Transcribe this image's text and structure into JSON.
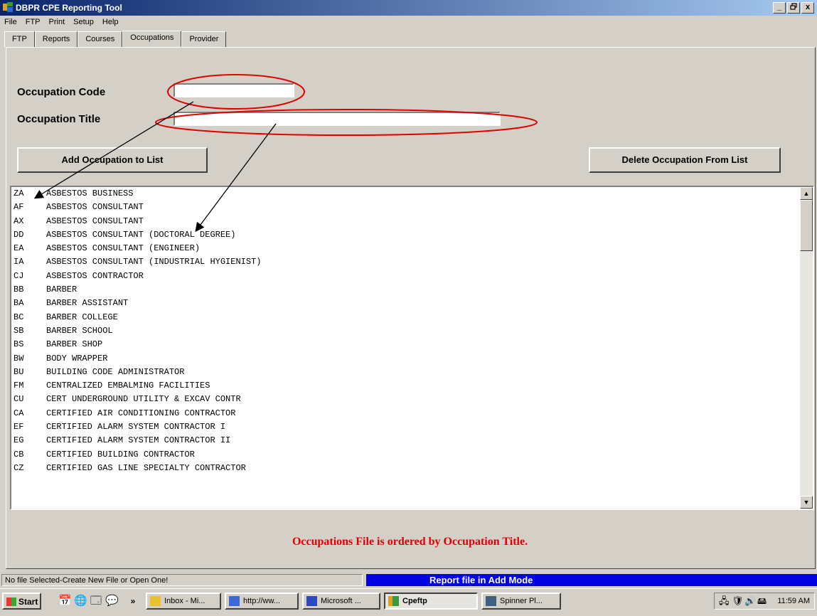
{
  "window": {
    "title": "DBPR CPE Reporting Tool",
    "controls": [
      "_",
      "ȸ",
      "x"
    ]
  },
  "menu": [
    "File",
    "FTP",
    "Print",
    "Setup",
    "Help"
  ],
  "tabs": [
    "FTP",
    "Reports",
    "Courses",
    "Occupations",
    "Provider"
  ],
  "active_tab": "Occupations",
  "form": {
    "code_label": "Occupation Code",
    "code_value": "",
    "title_label": "Occupation Title",
    "title_value": "",
    "add_button": "Add Occupation to List",
    "delete_button": "Delete Occupation From List"
  },
  "occupations": [
    {
      "code": "ZA",
      "title": "ASBESTOS BUSINESS"
    },
    {
      "code": "AF",
      "title": "ASBESTOS CONSULTANT"
    },
    {
      "code": "AX",
      "title": "ASBESTOS CONSULTANT"
    },
    {
      "code": "DD",
      "title": "ASBESTOS CONSULTANT (DOCTORAL DEGREE)"
    },
    {
      "code": "EA",
      "title": "ASBESTOS CONSULTANT (ENGINEER)"
    },
    {
      "code": "IA",
      "title": "ASBESTOS CONSULTANT (INDUSTRIAL HYGIENIST)"
    },
    {
      "code": "CJ",
      "title": "ASBESTOS CONTRACTOR"
    },
    {
      "code": "BB",
      "title": "BARBER"
    },
    {
      "code": "BA",
      "title": "BARBER ASSISTANT"
    },
    {
      "code": "BC",
      "title": "BARBER COLLEGE"
    },
    {
      "code": "SB",
      "title": "BARBER SCHOOL"
    },
    {
      "code": "BS",
      "title": "BARBER SHOP"
    },
    {
      "code": "BW",
      "title": "BODY WRAPPER"
    },
    {
      "code": "BU",
      "title": "BUILDING CODE ADMINISTRATOR"
    },
    {
      "code": "FM",
      "title": "CENTRALIZED EMBALMING FACILITIES"
    },
    {
      "code": "CU",
      "title": "CERT UNDERGROUND UTILITY & EXCAV CONTR"
    },
    {
      "code": "CA",
      "title": "CERTIFIED AIR CONDITIONING CONTRACTOR"
    },
    {
      "code": "EF",
      "title": "CERTIFIED ALARM SYSTEM CONTRACTOR I"
    },
    {
      "code": "EG",
      "title": "CERTIFIED ALARM SYSTEM CONTRACTOR II"
    },
    {
      "code": "CB",
      "title": "CERTIFIED BUILDING CONTRACTOR"
    },
    {
      "code": "CZ",
      "title": "CERTIFIED GAS LINE SPECIALTY CONTRACTOR"
    }
  ],
  "note": "Occupations File is ordered by Occupation Title.",
  "status": {
    "left": "No file Selected-Create New File or Open One!",
    "right": "Report file in Add Mode"
  },
  "taskbar": {
    "start": "Start",
    "overflow": "»",
    "tasks": [
      "Inbox - Mi...",
      "http://ww...",
      "Microsoft ...",
      "Cpeftp",
      "Spinner Pl..."
    ],
    "clock": "11:59 AM"
  },
  "colors": {
    "title_gradient_start": "#0a246a",
    "title_gradient_end": "#a6caf0",
    "annotation_red": "#e00000",
    "status_blue": "#0000e0"
  }
}
